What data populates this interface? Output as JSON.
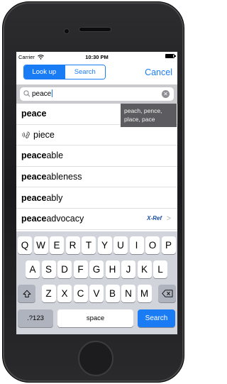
{
  "status_bar": {
    "carrier": "Carrier",
    "time": "10:30 PM"
  },
  "nav": {
    "segments": [
      {
        "label": "Look up",
        "selected": true
      },
      {
        "label": "Search",
        "selected": false
      }
    ],
    "cancel_label": "Cancel"
  },
  "search": {
    "value": "peace"
  },
  "suggestion_tooltip": {
    "line1": "peach, pence,",
    "line2": "place, pace"
  },
  "results": [
    {
      "bold": "peace",
      "rest": "",
      "audio": false,
      "xref": ""
    },
    {
      "bold": "",
      "rest": "piece",
      "audio": true,
      "xref": ""
    },
    {
      "bold": "peace",
      "rest": "able",
      "audio": false,
      "xref": ""
    },
    {
      "bold": "peace",
      "rest": "ableness",
      "audio": false,
      "xref": ""
    },
    {
      "bold": "peace",
      "rest": "ably",
      "audio": false,
      "xref": ""
    },
    {
      "bold": "peace",
      "rest": " advocacy",
      "audio": false,
      "xref": "X-Ref"
    }
  ],
  "keyboard": {
    "row1": [
      "Q",
      "W",
      "E",
      "R",
      "T",
      "Y",
      "U",
      "I",
      "O",
      "P"
    ],
    "row2": [
      "A",
      "S",
      "D",
      "F",
      "G",
      "H",
      "J",
      "K",
      "L"
    ],
    "row3": [
      "Z",
      "X",
      "C",
      "V",
      "B",
      "N",
      "M"
    ],
    "numbers_label": ".?123",
    "space_label": "space",
    "search_label": "Search"
  },
  "colors": {
    "accent": "#1a7cf5",
    "keyboard_bg": "#d1d4da",
    "tooltip_bg": "#5c5c60"
  }
}
